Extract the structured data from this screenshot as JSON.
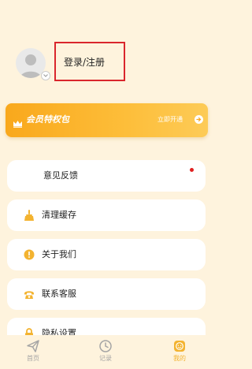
{
  "profile": {
    "login_label": "登录/注册"
  },
  "vip": {
    "title": "会员特权包",
    "action": "立即开通"
  },
  "menu": [
    {
      "label": "意见反馈",
      "icon": "feedback-icon",
      "has_dot": true
    },
    {
      "label": "清理缓存",
      "icon": "broom-icon",
      "has_dot": false
    },
    {
      "label": "关于我们",
      "icon": "info-icon",
      "has_dot": false
    },
    {
      "label": "联系客服",
      "icon": "phone-icon",
      "has_dot": false
    },
    {
      "label": "隐私设置",
      "icon": "lock-icon",
      "has_dot": false
    }
  ],
  "tabs": [
    {
      "label": "首页",
      "icon": "paper-plane-icon",
      "active": false
    },
    {
      "label": "记录",
      "icon": "clock-icon",
      "active": false
    },
    {
      "label": "我的",
      "icon": "smile-icon",
      "active": true
    }
  ],
  "colors": {
    "background": "#FEF3DD",
    "accent": "#F9A81C",
    "tab_inactive": "#A5A5A5",
    "tab_active": "#F3B330",
    "highlight_box": "#D9262C"
  }
}
